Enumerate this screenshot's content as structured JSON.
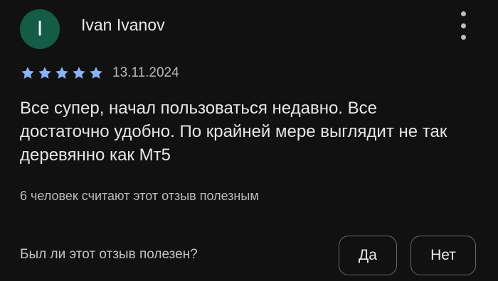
{
  "review": {
    "avatar_letter": "I",
    "author_name": "Ivan Ivanov",
    "rating": 5,
    "rating_max": 5,
    "date": "13.11.2024",
    "text": "Все супер, начал пользоваться недавно. Все достаточно удобно. По крайней мере выглядит не так деревянно как Мт5",
    "helpful_count_text": "6 человек считают этот отзыв полезным"
  },
  "feedback": {
    "question": "Был ли этот отзыв полезен?",
    "yes_label": "Да",
    "no_label": "Нет"
  },
  "icons": {
    "menu": "more-vert-icon",
    "star": "star-icon"
  },
  "colors": {
    "background": "#111111",
    "avatar": "#145c46",
    "star": "#8ab4f8"
  }
}
